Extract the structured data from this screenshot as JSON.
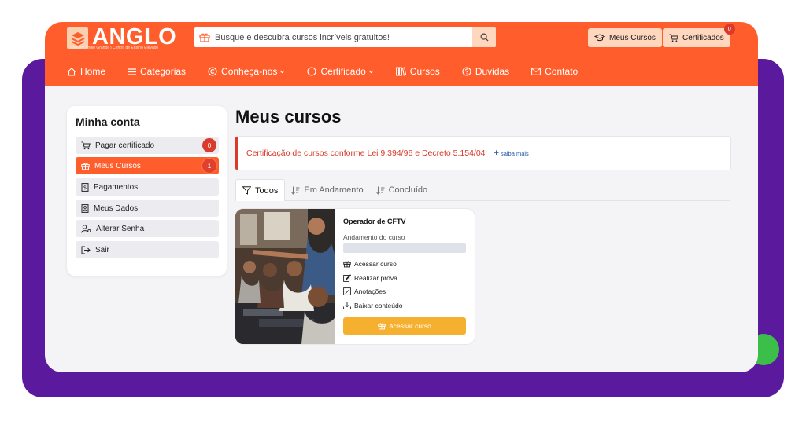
{
  "header": {
    "logo_text": "ANGLO",
    "logo_tagline": "Ebrasfly Anglo Grande | Centro de Ensino Elevado",
    "search_placeholder": "Busque e descubra cursos incríveis gratuitos!",
    "my_courses_label": "Meus Cursos",
    "certificates_label": "Certificados",
    "certificates_count": "0"
  },
  "nav": {
    "items": [
      {
        "label": "Home",
        "icon": "home-icon"
      },
      {
        "label": "Categorias",
        "icon": "menu-icon"
      },
      {
        "label": "Conheça-nos",
        "icon": "copyright-icon",
        "dropdown": true
      },
      {
        "label": "Certificado",
        "icon": "circle-icon",
        "dropdown": true
      },
      {
        "label": "Cursos",
        "icon": "books-icon"
      },
      {
        "label": "Duvidas",
        "icon": "question-icon"
      },
      {
        "label": "Contato",
        "icon": "mail-icon"
      }
    ]
  },
  "sidebar": {
    "title": "Minha conta",
    "items": [
      {
        "label": "Pagar certificado",
        "badge": "0",
        "active": false
      },
      {
        "label": "Meus Cursos",
        "badge": "1",
        "active": true
      },
      {
        "label": "Pagamentos"
      },
      {
        "label": "Meus Dados"
      },
      {
        "label": "Alterar Senha"
      },
      {
        "label": "Sair"
      }
    ]
  },
  "main": {
    "title": "Meus cursos",
    "alert": {
      "message": "Certificação de cursos conforme Lei 9.394/96 e Decreto 5.154/04",
      "more_label": "saiba mais"
    },
    "tabs": [
      {
        "label": "Todos",
        "active": true
      },
      {
        "label": "Em Andamento",
        "active": false
      },
      {
        "label": "Concluído",
        "active": false
      }
    ],
    "course": {
      "title": "Operador de CFTV",
      "progress_label": "Andamento do curso",
      "progress": 0,
      "actions": [
        {
          "label": "Acessar curso",
          "icon": "gift-icon"
        },
        {
          "label": "Realizar prova",
          "icon": "edit-icon"
        },
        {
          "label": "Anotações",
          "icon": "note-icon"
        },
        {
          "label": "Baixar conteúdo",
          "icon": "download-icon"
        }
      ],
      "cta_label": "Acessar curso"
    }
  },
  "colors": {
    "brand": "#ff5e2c",
    "accent": "#f5b030",
    "alert": "#d93a2b",
    "frame": "#5b1a9e",
    "link": "#2557a7"
  }
}
